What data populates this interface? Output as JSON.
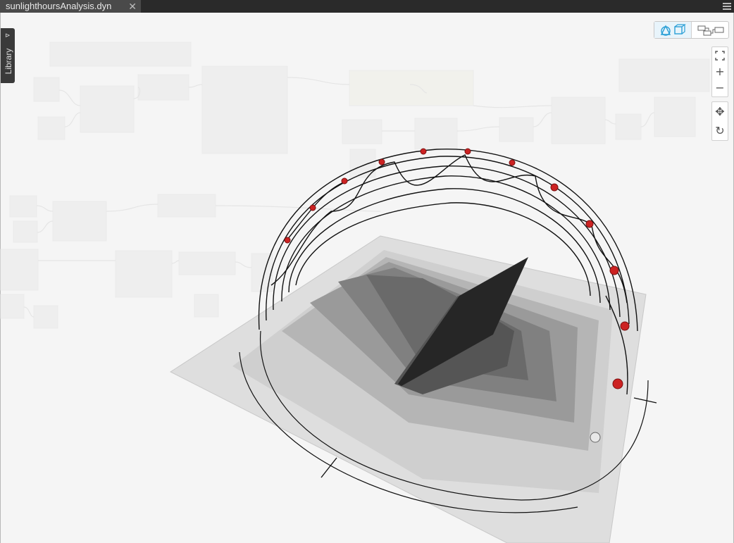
{
  "tab": {
    "title": "sunlighthoursAnalysis.dyn",
    "close_glyph": "✕"
  },
  "library": {
    "label": "Library"
  },
  "view_toggle": {
    "geometry_view_icon": "geometry-shapes-icon",
    "graph_view_icon": "node-graph-icon",
    "active": "geometry"
  },
  "nav_controls": {
    "zoom_extents_icon": "zoom-extents-icon",
    "zoom_in_glyph": "+",
    "zoom_out_glyph": "−",
    "pan_glyph": "✥",
    "orbit_glyph": "↻"
  },
  "colors": {
    "tab_bg": "#4a4a4a",
    "tabbar_bg": "#2a2a2a",
    "canvas_bg": "#f5f5f5",
    "sun_marker": "#cc2222",
    "accent": "#2a9fd6"
  }
}
